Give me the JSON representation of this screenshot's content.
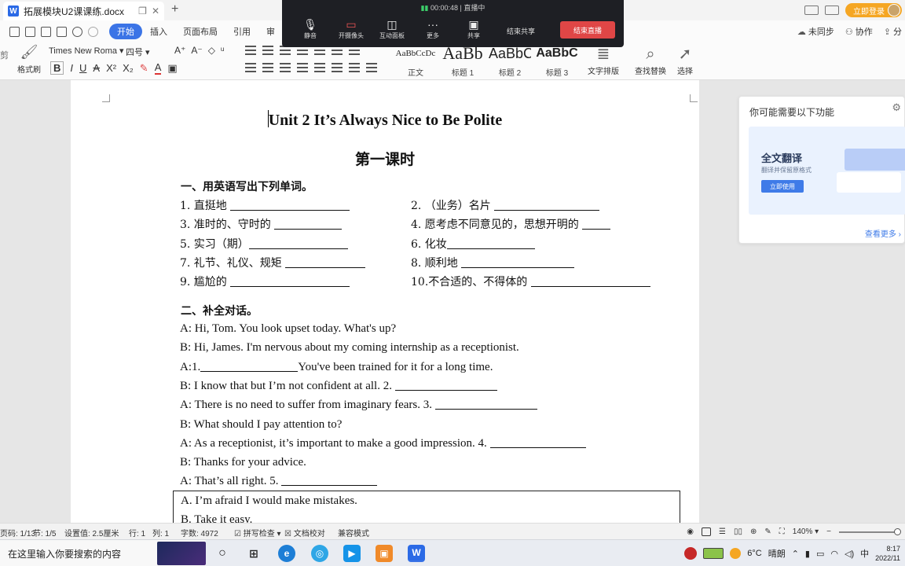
{
  "window": {
    "tab_title": "拓展模块U2课课练.docx",
    "login_label": "立即登录"
  },
  "menu": {
    "items": [
      "开始",
      "插入",
      "页面布局",
      "引用",
      "审"
    ],
    "active": "开始",
    "right": [
      "未同步",
      "协作",
      "分"
    ]
  },
  "ribbon": {
    "format_painter": "格式刷",
    "paste_partial": "剪",
    "font_name": "Times New Roma",
    "font_size": "四号",
    "styles": [
      {
        "preview": "AaBbCcDc",
        "name": "正文",
        "size": "11px"
      },
      {
        "preview": "AaBb",
        "name": "标题 1",
        "size": "22px"
      },
      {
        "preview": "AaBbC",
        "name": "标题 2",
        "size": "18px"
      },
      {
        "preview": "AaBbC",
        "name": "标题 3",
        "size": "16px"
      }
    ],
    "text_layout": "文字排版",
    "find_replace": "查找替换",
    "select": "选择"
  },
  "meeting": {
    "timer": "00:00:48",
    "status": "直播中",
    "buttons": [
      {
        "icon": "mic",
        "label": "静音"
      },
      {
        "icon": "camera-off",
        "label": "开摄像头"
      },
      {
        "icon": "interact",
        "label": "互动面板"
      },
      {
        "icon": "more",
        "label": "更多"
      },
      {
        "icon": "share",
        "label": "共享"
      }
    ],
    "end_share": "结束共享",
    "end_live": "结束直播"
  },
  "document": {
    "title": "Unit 2 It’s Always Nice to Be Polite",
    "subtitle": "第一课时",
    "section1_heading": "一、用英语写出下列单词。",
    "vocab": [
      {
        "left": "1.  直挺地",
        "right": "2.  （业务）名片"
      },
      {
        "left": "3.  准时的、守时的",
        "right": "4.  愿考虑不同意见的，思想开明的"
      },
      {
        "left": "5.  实习（期）",
        "right": "6.  化妆"
      },
      {
        "left": "7.  礼节、礼仪、规矩",
        "right": "8.   顺利地"
      },
      {
        "left": "9.  尴尬的",
        "right": "10.不合适的、不得体的"
      }
    ],
    "section2_heading": "二、补全对话。",
    "dialogue": [
      "A: Hi, Tom. You look upset today. What's up?",
      "B: Hi, James. I'm nervous about my coming internship as a receptionist.",
      "A:1.",
      "You've been trained for it for a long time.",
      "B: I know that but I’m not confident at all. 2. ",
      "A: There is no need to suffer from imaginary fears. 3. ",
      "B: What should I pay attention to?",
      "A: As a receptionist, it’s important to make a good impression. 4. ",
      "B: Thanks for your advice.",
      "A: That’s all right. 5. "
    ],
    "options": [
      "A. I’m afraid I would make mistakes.",
      "B. Take it easy."
    ]
  },
  "side_panel": {
    "title": "你可能需要以下功能",
    "card_title": "全文翻译",
    "card_desc": "翻译并保留原格式",
    "card_button": "立即使用",
    "more_link": "查看更多"
  },
  "status": {
    "page": "页码: 1/13",
    "section": "节: 1/5",
    "setting": "设置值: 2.5厘米",
    "line": "行: 1",
    "column": "列: 1",
    "words": "字数: 4972",
    "spellcheck": "拼写检查",
    "proofread": "文档校对",
    "compat": "兼容模式",
    "zoom": "140%"
  },
  "taskbar": {
    "search_placeholder": "在这里输入你要搜索的内容",
    "temperature": "6°C",
    "weather": "晴朗",
    "ime": "中",
    "time": "8:17",
    "date": "2022/11"
  }
}
